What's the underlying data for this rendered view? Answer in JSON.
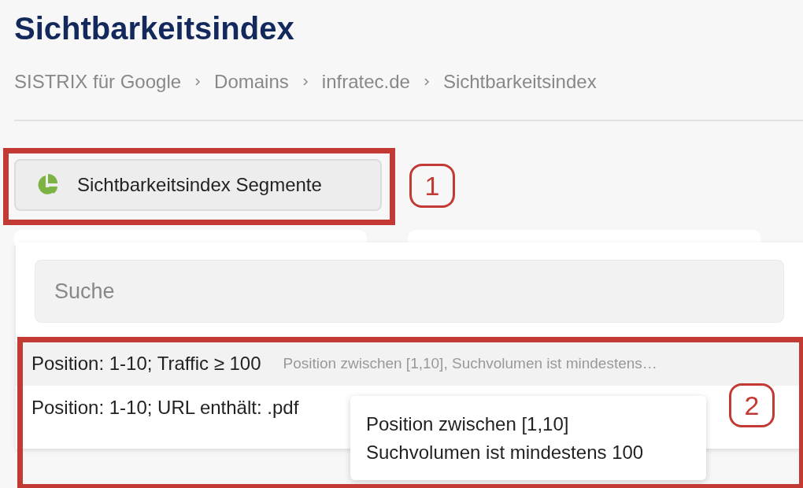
{
  "page": {
    "title": "Sichtbarkeitsindex"
  },
  "breadcrumb": [
    "SISTRIX für Google",
    "Domains",
    "infratec.de",
    "Sichtbarkeitsindex"
  ],
  "segment_button": {
    "label": "Sichtbarkeitsindex Segmente"
  },
  "dropdown": {
    "search": {
      "placeholder": "Suche"
    },
    "items": [
      {
        "label": "Position: 1-10; Traffic ≥ 100",
        "description": "Position zwischen [1,10], Suchvolumen ist mindestens…",
        "selected": true
      },
      {
        "label": "Position: 1-10; URL enthält: .pdf",
        "selected": false
      }
    ],
    "tooltip": [
      "Position zwischen [1,10]",
      "Suchvolumen ist mindestens 100"
    ]
  },
  "annotations": [
    "1",
    "2"
  ]
}
